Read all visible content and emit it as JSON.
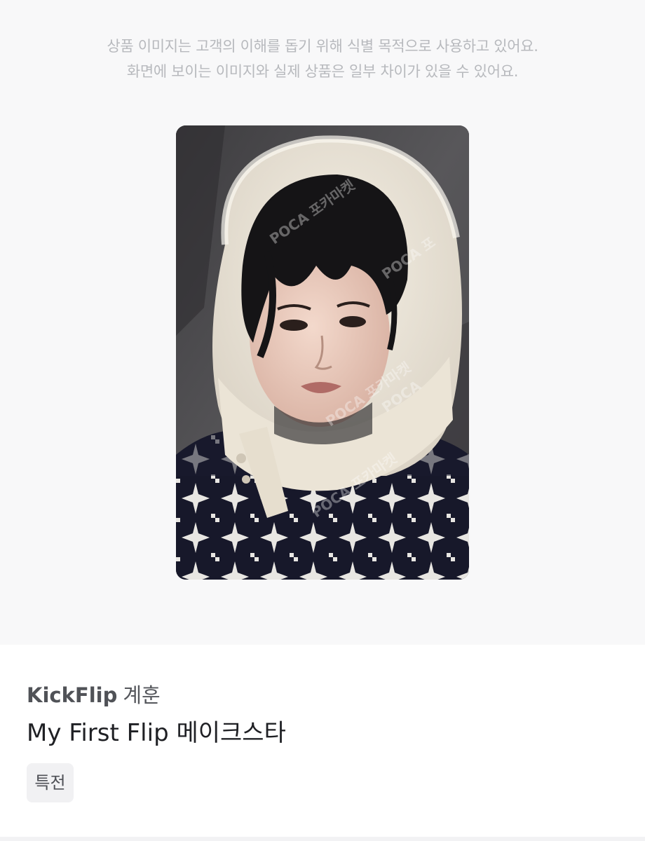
{
  "notice": {
    "line1": "상품 이미지는 고객의 이해를 돕기 위해 식별 목적으로 사용하고 있어요.",
    "line2": "화면에 보이는 이미지와 실제 상품은 일부 차이가 있을 수 있어요."
  },
  "product_image": {
    "watermark": "POCA 포카마켓"
  },
  "product": {
    "group": "KickFlip",
    "member": "계훈",
    "album": "My First Flip 메이크스타",
    "tag": "특전"
  }
}
